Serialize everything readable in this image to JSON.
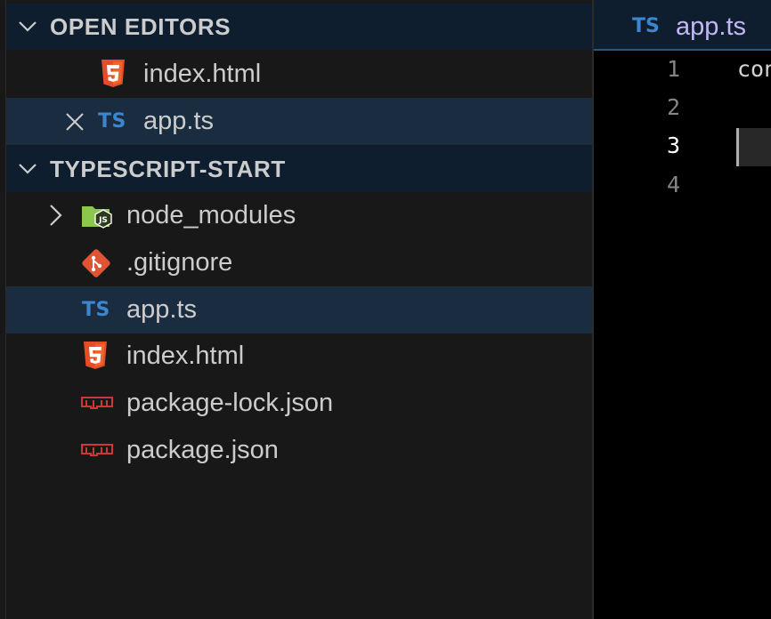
{
  "explorer": {
    "open_editors": {
      "title": "OPEN EDITORS",
      "items": [
        {
          "label": "index.html",
          "icon": "html5-icon"
        },
        {
          "label": "app.ts",
          "icon": "typescript-icon",
          "icon_text": "TS",
          "close_icon": "close-icon",
          "selected": true
        }
      ]
    },
    "project": {
      "title": "TYPESCRIPT-START",
      "items": [
        {
          "label": "node_modules",
          "icon": "nodejs-folder-icon",
          "expand_icon": "chevron-right-icon"
        },
        {
          "label": ".gitignore",
          "icon": "git-icon"
        },
        {
          "label": "app.ts",
          "icon": "typescript-icon",
          "icon_text": "TS",
          "selected": true
        },
        {
          "label": "index.html",
          "icon": "html5-icon"
        },
        {
          "label": "package-lock.json",
          "icon": "npm-icon"
        },
        {
          "label": "package.json",
          "icon": "npm-icon"
        }
      ]
    }
  },
  "editor": {
    "tab": {
      "icon_text": "TS",
      "label": "app.ts"
    },
    "line_numbers": [
      "1",
      "2",
      "3",
      "4"
    ],
    "active_line": "3",
    "code_lines": [
      "con",
      "",
      "",
      ""
    ]
  },
  "colors": {
    "header_bg": "#0e1e2e",
    "selected_bg": "#1a2c3f",
    "ts_blue": "#3c86cf",
    "html_orange": "#e44d26",
    "git_orange": "#e05333",
    "npm_red": "#cb3837",
    "node_green": "#8cc84b",
    "tab_text": "#c4b6f3"
  }
}
